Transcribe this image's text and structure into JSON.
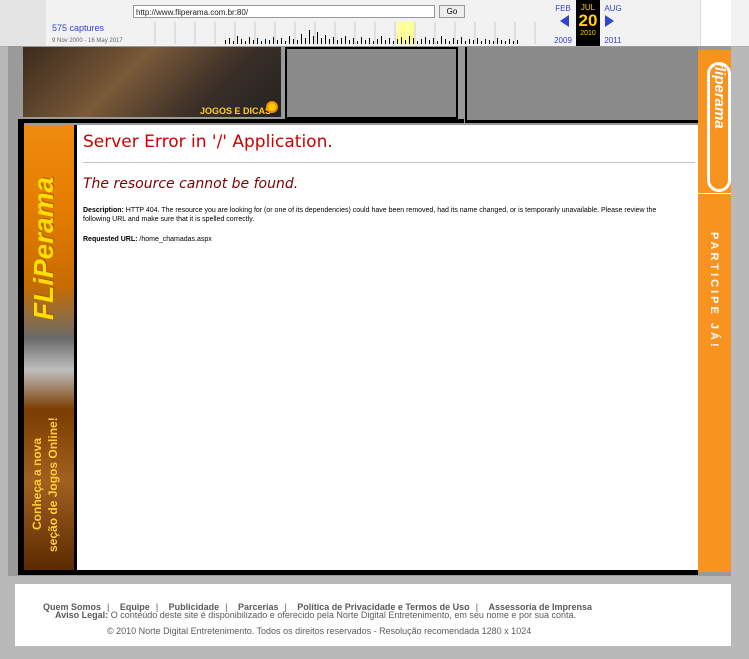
{
  "wayback": {
    "url": "http://www.fliperama.com.br:80/",
    "go_label": "Go",
    "captures": "575 captures",
    "date_range": "9 Nov 2000 - 16 May 2017",
    "prev_month": "FEB",
    "prev_year": "2009",
    "cur_month": "JUL",
    "cur_day": "20",
    "cur_year": "2010",
    "next_month": "AUG",
    "next_year": "2011"
  },
  "banner": {
    "dicas": "JOGOS E DICAS"
  },
  "left_banner": {
    "logo": "FLiPerama",
    "line1": "Conheça a nova",
    "line2": "seção de Jogos Online!"
  },
  "right_banner": {
    "logo": "fliperama",
    "cta": "PARTICIPE JÁ!"
  },
  "error": {
    "title": "Server Error in '/' Application.",
    "subtitle": "The resource cannot be found.",
    "desc_label": "Description:",
    "desc_text": "HTTP 404. The resource you are looking for (or one of its dependencies) could have been removed, had its name changed, or is temporarily unavailable.  Please review the following URL and make sure that it is spelled correctly.",
    "req_label": "Requested URL:",
    "req_value": "/home_chamadas.aspx"
  },
  "footer": {
    "links": [
      "Quem Somos",
      "Equipe",
      "Publicidade",
      "Parcerias",
      "Política de Privacidade e Termos de Uso",
      "Assessoria de Imprensa"
    ],
    "aviso_label": "Aviso Legal:",
    "aviso_text": "O conteúdo deste site é disponibilizado e oferecido pela Norte Digital Entretenimento, em seu nome e por sua conta.",
    "copyright": "© 2010 Norte Digital Entretenimento. Todos os direitos reservados - Resolução recomendada 1280 x 1024"
  }
}
